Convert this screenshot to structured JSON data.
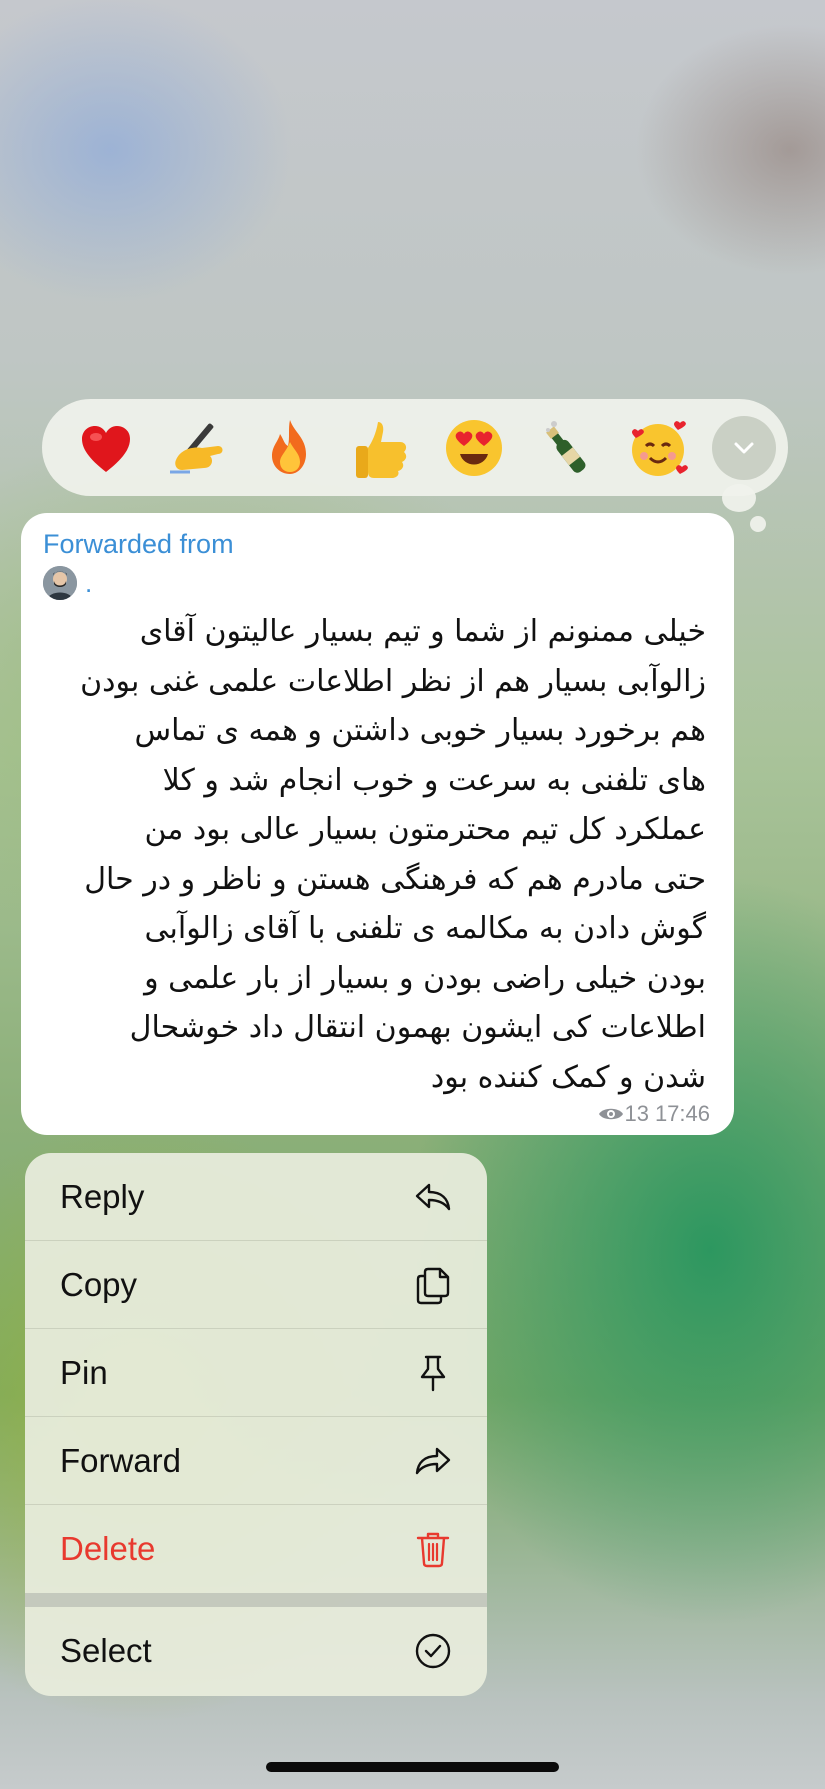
{
  "reactions": [
    {
      "name": "red-heart"
    },
    {
      "name": "writing-hand"
    },
    {
      "name": "fire"
    },
    {
      "name": "thumbs-up"
    },
    {
      "name": "heart-eyes"
    },
    {
      "name": "champagne-bottle"
    },
    {
      "name": "smiling-face-with-hearts"
    }
  ],
  "message": {
    "forwarded_label": "Forwarded from",
    "forwarded_name": ".",
    "lines": [
      "خیلی ممنونم از شما و تیم بسیار عالیتون آقای",
      "زالوآبی بسیار هم از نظر اطلاعات علمی غنی بودن",
      "هم برخورد بسیار خوبی داشتن و همه ی تماس",
      "های تلفنی به سرعت و خوب انجام شد و کلا",
      "عملکرد کل تیم محترمتون بسیار عالی بود من",
      "حتی مادرم هم که فرهنگی هستن و ناظر و در حال",
      "گوش دادن به مکالمه ی تلفنی با آقای زالوآبی",
      "بودن خیلی راضی بودن و بسیار از بار علمی و",
      "اطلاعات کی ایشون بهمون انتقال داد خوشحال",
      "شدن و کمک کننده بود"
    ],
    "views": "13",
    "time": "17:46"
  },
  "menu": {
    "reply": "Reply",
    "copy": "Copy",
    "pin": "Pin",
    "forward": "Forward",
    "delete": "Delete",
    "select": "Select"
  },
  "colors": {
    "link": "#3b8fd6",
    "danger": "#e8392e"
  }
}
